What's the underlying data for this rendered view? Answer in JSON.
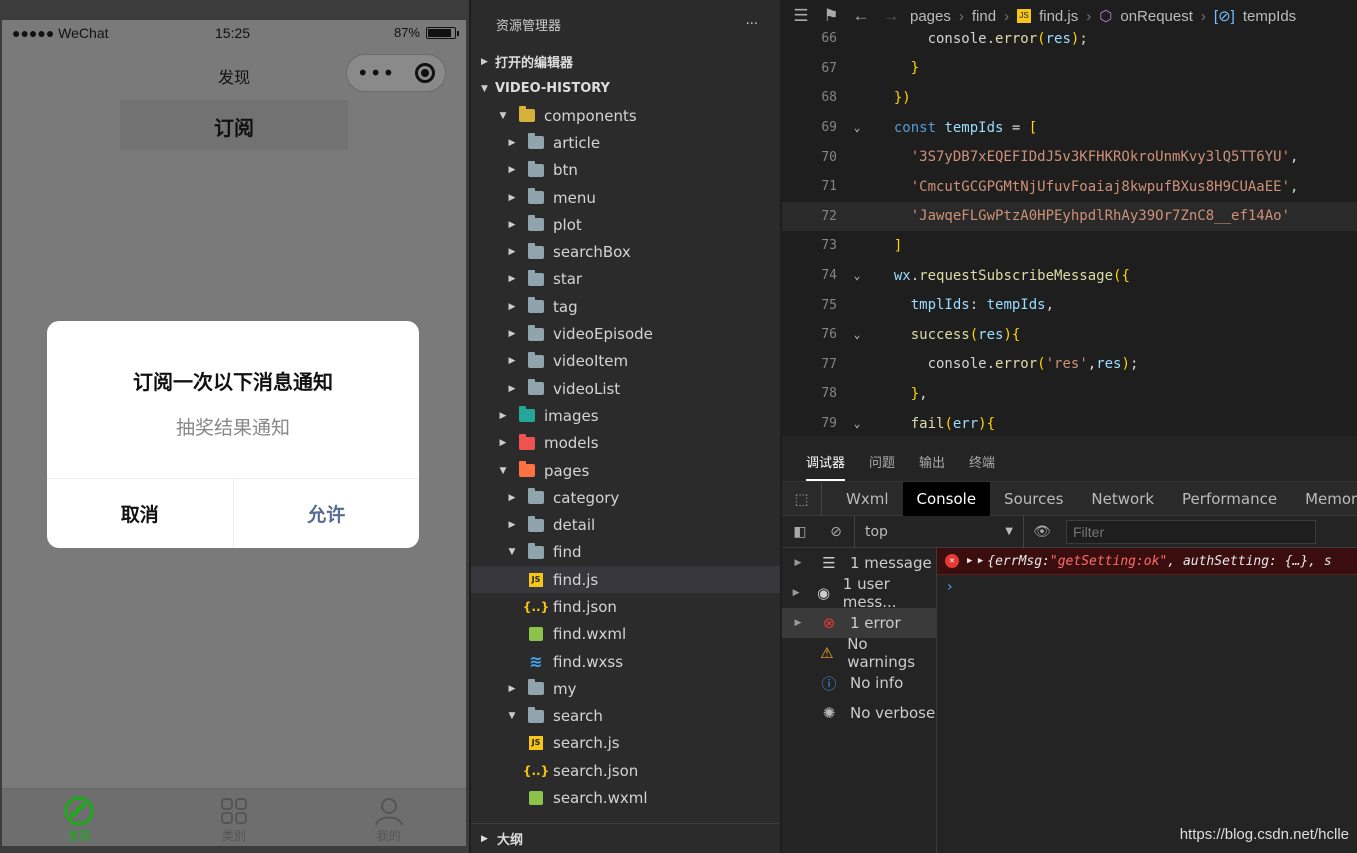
{
  "phone": {
    "carrier": "●●●●● WeChat",
    "time": "15:25",
    "battery": "87%",
    "nav_title": "发现",
    "sub_tab": "订阅",
    "modal": {
      "title": "订阅一次以下消息通知",
      "body": "抽奖结果通知",
      "cancel": "取消",
      "allow": "允许"
    },
    "tabs": [
      {
        "label": "发现",
        "icon": "discover-icon"
      },
      {
        "label": "类别",
        "icon": "grid-icon"
      },
      {
        "label": "我的",
        "icon": "user-icon"
      }
    ]
  },
  "explorer": {
    "title": "资源管理器",
    "more": "···",
    "open_editors": "打开的编辑器",
    "project": "VIDEO-HISTORY",
    "outline": "大纲",
    "rows": [
      {
        "label": "components",
        "depth": 1,
        "kind": "folder-yellow",
        "open": true
      },
      {
        "label": "article",
        "depth": 2,
        "kind": "folder"
      },
      {
        "label": "btn",
        "depth": 2,
        "kind": "folder"
      },
      {
        "label": "menu",
        "depth": 2,
        "kind": "folder"
      },
      {
        "label": "plot",
        "depth": 2,
        "kind": "folder"
      },
      {
        "label": "searchBox",
        "depth": 2,
        "kind": "folder"
      },
      {
        "label": "star",
        "depth": 2,
        "kind": "folder"
      },
      {
        "label": "tag",
        "depth": 2,
        "kind": "folder"
      },
      {
        "label": "videoEpisode",
        "depth": 2,
        "kind": "folder"
      },
      {
        "label": "videoItem",
        "depth": 2,
        "kind": "folder"
      },
      {
        "label": "videoList",
        "depth": 2,
        "kind": "folder"
      },
      {
        "label": "images",
        "depth": 1,
        "kind": "folder-green"
      },
      {
        "label": "models",
        "depth": 1,
        "kind": "folder-red"
      },
      {
        "label": "pages",
        "depth": 1,
        "kind": "folder-orange",
        "open": true
      },
      {
        "label": "category",
        "depth": 2,
        "kind": "folder"
      },
      {
        "label": "detail",
        "depth": 2,
        "kind": "folder"
      },
      {
        "label": "find",
        "depth": 2,
        "kind": "folder",
        "open": true
      },
      {
        "label": "find.js",
        "depth": 3,
        "kind": "js",
        "selected": true
      },
      {
        "label": "find.json",
        "depth": 3,
        "kind": "json"
      },
      {
        "label": "find.wxml",
        "depth": 3,
        "kind": "wxml"
      },
      {
        "label": "find.wxss",
        "depth": 3,
        "kind": "wxss"
      },
      {
        "label": "my",
        "depth": 2,
        "kind": "folder"
      },
      {
        "label": "search",
        "depth": 2,
        "kind": "folder",
        "open": true
      },
      {
        "label": "search.js",
        "depth": 3,
        "kind": "js"
      },
      {
        "label": "search.json",
        "depth": 3,
        "kind": "json"
      },
      {
        "label": "search.wxml",
        "depth": 3,
        "kind": "wxml"
      }
    ]
  },
  "editor": {
    "breadcrumbs": [
      "pages",
      "find",
      "find.js",
      "onRequest",
      "tempIds"
    ],
    "lines": [
      {
        "n": "66",
        "fold": "",
        "html": "      console.<span class=\"f\">error</span><span class=\"p\">(</span><span class=\"v\">res</span><span class=\"p\">)</span>;"
      },
      {
        "n": "67",
        "fold": "",
        "html": "    <span class=\"p\">}</span>"
      },
      {
        "n": "68",
        "fold": "",
        "html": "  <span class=\"p\">})</span>"
      },
      {
        "n": "69",
        "fold": "⌄",
        "html": "  <span class=\"k\">const</span> <span class=\"v\">tempIds</span> = <span class=\"p\">[</span>"
      },
      {
        "n": "70",
        "fold": "",
        "html": "    <span class=\"s\">'3S7yDB7xEQEFIDdJ5v3KFHKROkroUnmKvy3lQ5TT6YU'</span>,"
      },
      {
        "n": "71",
        "fold": "",
        "html": "    <span class=\"s\">'CmcutGCGPGMtNjUfuvFoaiaj8kwpufBXus8H9CUAaEE'</span>,"
      },
      {
        "n": "72",
        "fold": "",
        "html": "    <span class=\"s\">'JawqeFLGwPtzA0HPEyhpdlRhAy39Or7ZnC8__ef14Ao'</span>",
        "hl": true
      },
      {
        "n": "73",
        "fold": "",
        "html": "  <span class=\"p\">]</span>"
      },
      {
        "n": "74",
        "fold": "⌄",
        "html": "  <span class=\"v\">wx</span>.<span class=\"f\">requestSubscribeMessage</span><span class=\"p\">({</span>"
      },
      {
        "n": "75",
        "fold": "",
        "html": "    <span class=\"v\">tmplIds</span>: <span class=\"v\">tempIds</span>,"
      },
      {
        "n": "76",
        "fold": "⌄",
        "html": "    <span class=\"f\">success</span><span class=\"p\">(</span><span class=\"v\">res</span><span class=\"p\">){</span>"
      },
      {
        "n": "77",
        "fold": "",
        "html": "      console.<span class=\"f\">error</span><span class=\"p\">(</span><span class=\"s\">'res'</span>,<span class=\"v\">res</span><span class=\"p\">)</span>;"
      },
      {
        "n": "78",
        "fold": "",
        "html": "    <span class=\"p\">}</span>,"
      },
      {
        "n": "79",
        "fold": "⌄",
        "html": "    <span class=\"f\">fail</span><span class=\"p\">(</span><span class=\"v\">err</span><span class=\"p\">){</span>"
      }
    ]
  },
  "devtools": {
    "tabs": [
      "调试器",
      "问题",
      "输出",
      "终端"
    ],
    "panels": [
      "Wxml",
      "Console",
      "Sources",
      "Network",
      "Performance",
      "Memory"
    ],
    "context": "top",
    "filter_placeholder": "Filter",
    "sidebar": [
      {
        "label": "1 message",
        "icon": "list-icon",
        "tri": true
      },
      {
        "label": "1 user mess...",
        "icon": "user-circle-icon",
        "tri": true
      },
      {
        "label": "1 error",
        "icon": "error-icon",
        "tri": true,
        "selected": true
      },
      {
        "label": "No warnings",
        "icon": "warning-icon"
      },
      {
        "label": "No info",
        "icon": "info-icon"
      },
      {
        "label": "No verbose",
        "icon": "bug-icon"
      }
    ],
    "error_text_1": "{errMsg: ",
    "error_str": "\"getSetting:ok\"",
    "error_text_2": ", authSetting: {…}, s",
    "prompt": "›"
  },
  "watermark": "https://blog.csdn.net/hclle"
}
